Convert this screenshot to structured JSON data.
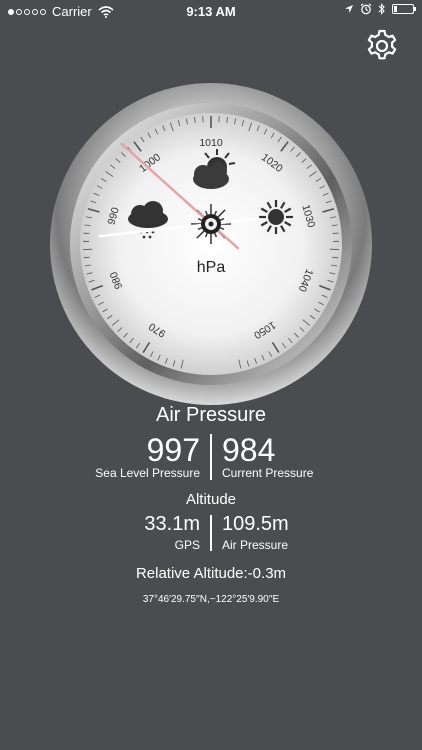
{
  "status_bar": {
    "carrier": "Carrier",
    "time": "9:13 AM",
    "signal_dots_filled": 1,
    "battery_level": 0.15
  },
  "header": {
    "settings_icon": "gear-icon"
  },
  "gauge": {
    "ticks": [
      "970",
      "980",
      "990",
      "1000",
      "1010",
      "1020",
      "1030",
      "1040",
      "1050"
    ],
    "unit": "hPa",
    "icons": [
      "rain-cloud-icon",
      "sun-cloud-icon",
      "sun-icon"
    ],
    "needle_sea_level": 997,
    "needle_current": 984,
    "needle_colors": {
      "sea_level": "#e6a2a4",
      "current": "#ffffff"
    }
  },
  "air_pressure": {
    "title": "Air Pressure",
    "sea_level_value": "997",
    "sea_level_label": "Sea Level Pressure",
    "current_value": "984",
    "current_label": "Current Pressure"
  },
  "altitude": {
    "title": "Altitude",
    "gps_value": "33.1m",
    "gps_label": "GPS",
    "air_value": "109.5m",
    "air_label": "Air Pressure"
  },
  "relative_altitude": "Relative Altitude:-0.3m",
  "coordinates": "37°46′29.75′′N,−122°25′9.90′′E"
}
